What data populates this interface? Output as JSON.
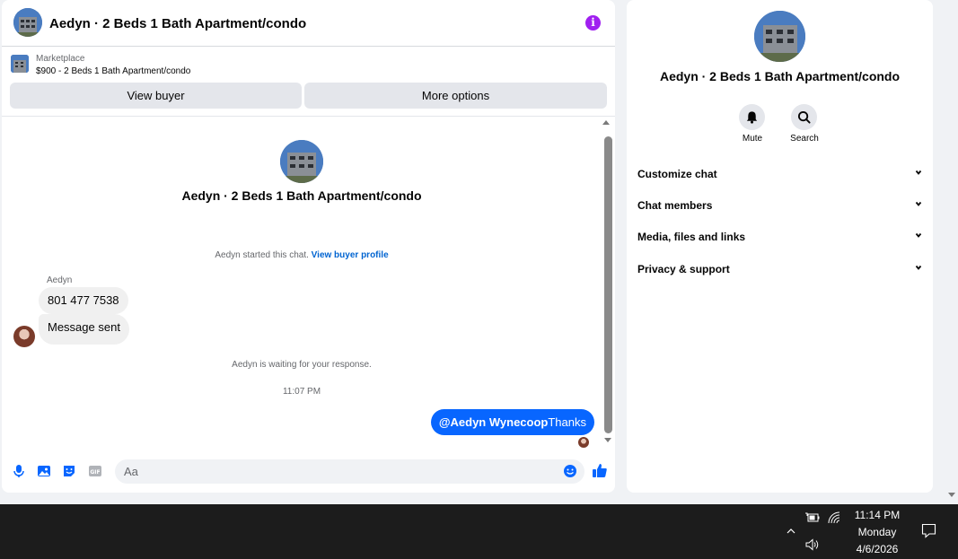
{
  "chat": {
    "title": "Aedyn · 2 Beds 1 Bath Apartment/condo",
    "marketplace_label": "Marketplace",
    "listing": "$900 - 2 Beds 1 Bath Apartment/condo",
    "view_buyer_label": "View buyer",
    "more_options_label": "More options",
    "intro_title": "Aedyn · 2 Beds 1 Bath Apartment/condo",
    "started_text": "Aedyn started this chat.",
    "view_buyer_profile": "View buyer profile",
    "sender_name": "Aedyn",
    "incoming_messages": [
      "801 477 7538",
      "Message sent"
    ],
    "waiting_text": "Aedyn is waiting for your response.",
    "timestamp": "11:07 PM",
    "outgoing_mention": "@Aedyn Wynecoop",
    "outgoing_text": "Thanks",
    "composer_placeholder": "Aa",
    "accent_color": "#0866ff"
  },
  "info": {
    "title": "Aedyn · 2 Beds 1 Bath Apartment/condo",
    "mute_label": "Mute",
    "search_label": "Search",
    "sections": [
      "Customize chat",
      "Chat members",
      "Media, files and links",
      "Privacy & support"
    ]
  },
  "taskbar": {
    "time": "11:14 PM",
    "day": "Monday",
    "date": "4/6/2026"
  },
  "icons": [
    "info-icon",
    "microphone-icon",
    "photo-icon",
    "sticker-icon",
    "gif-icon",
    "emoji-icon",
    "thumbs-up-icon",
    "bell-icon",
    "search-icon",
    "chevron-down-icon",
    "battery-icon",
    "wifi-icon",
    "volume-icon",
    "notification-icon"
  ]
}
